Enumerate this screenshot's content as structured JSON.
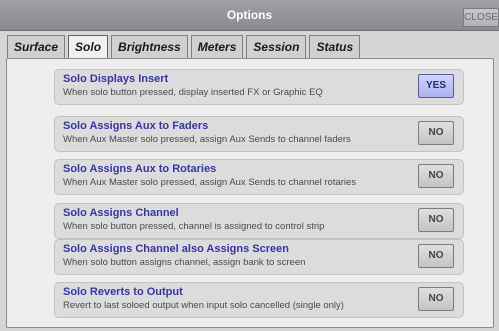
{
  "window": {
    "title": "Options",
    "close_label": "CLOSE"
  },
  "tabs": [
    {
      "label": "Surface"
    },
    {
      "label": "Solo",
      "active": true
    },
    {
      "label": "Brightness"
    },
    {
      "label": "Meters"
    },
    {
      "label": "Session"
    },
    {
      "label": "Status"
    }
  ],
  "options": [
    {
      "title": "Solo Displays Insert",
      "description": "When solo button pressed, display inserted FX or Graphic EQ",
      "value": "YES"
    },
    {
      "title": "Solo Assigns Aux to Faders",
      "description": "When Aux Master solo pressed, assign Aux Sends to channel faders",
      "value": "NO"
    },
    {
      "title": "Solo Assigns Aux to Rotaries",
      "description": "When Aux Master solo pressed, assign Aux Sends to channel rotaries",
      "value": "NO"
    },
    {
      "title": "Solo Assigns Channel",
      "description": "When solo button pressed, channel is assigned to control strip",
      "value": "NO"
    },
    {
      "title": "Solo Assigns Channel also Assigns Screen",
      "description": "When solo button assigns channel, assign bank to screen",
      "value": "NO"
    },
    {
      "title": "Solo Reverts to Output",
      "description": "Revert to last soloed output when input solo cancelled (single only)",
      "value": "NO"
    }
  ],
  "colors": {
    "option_title": "#3535a3",
    "toggle_on": "#aab2ee"
  }
}
